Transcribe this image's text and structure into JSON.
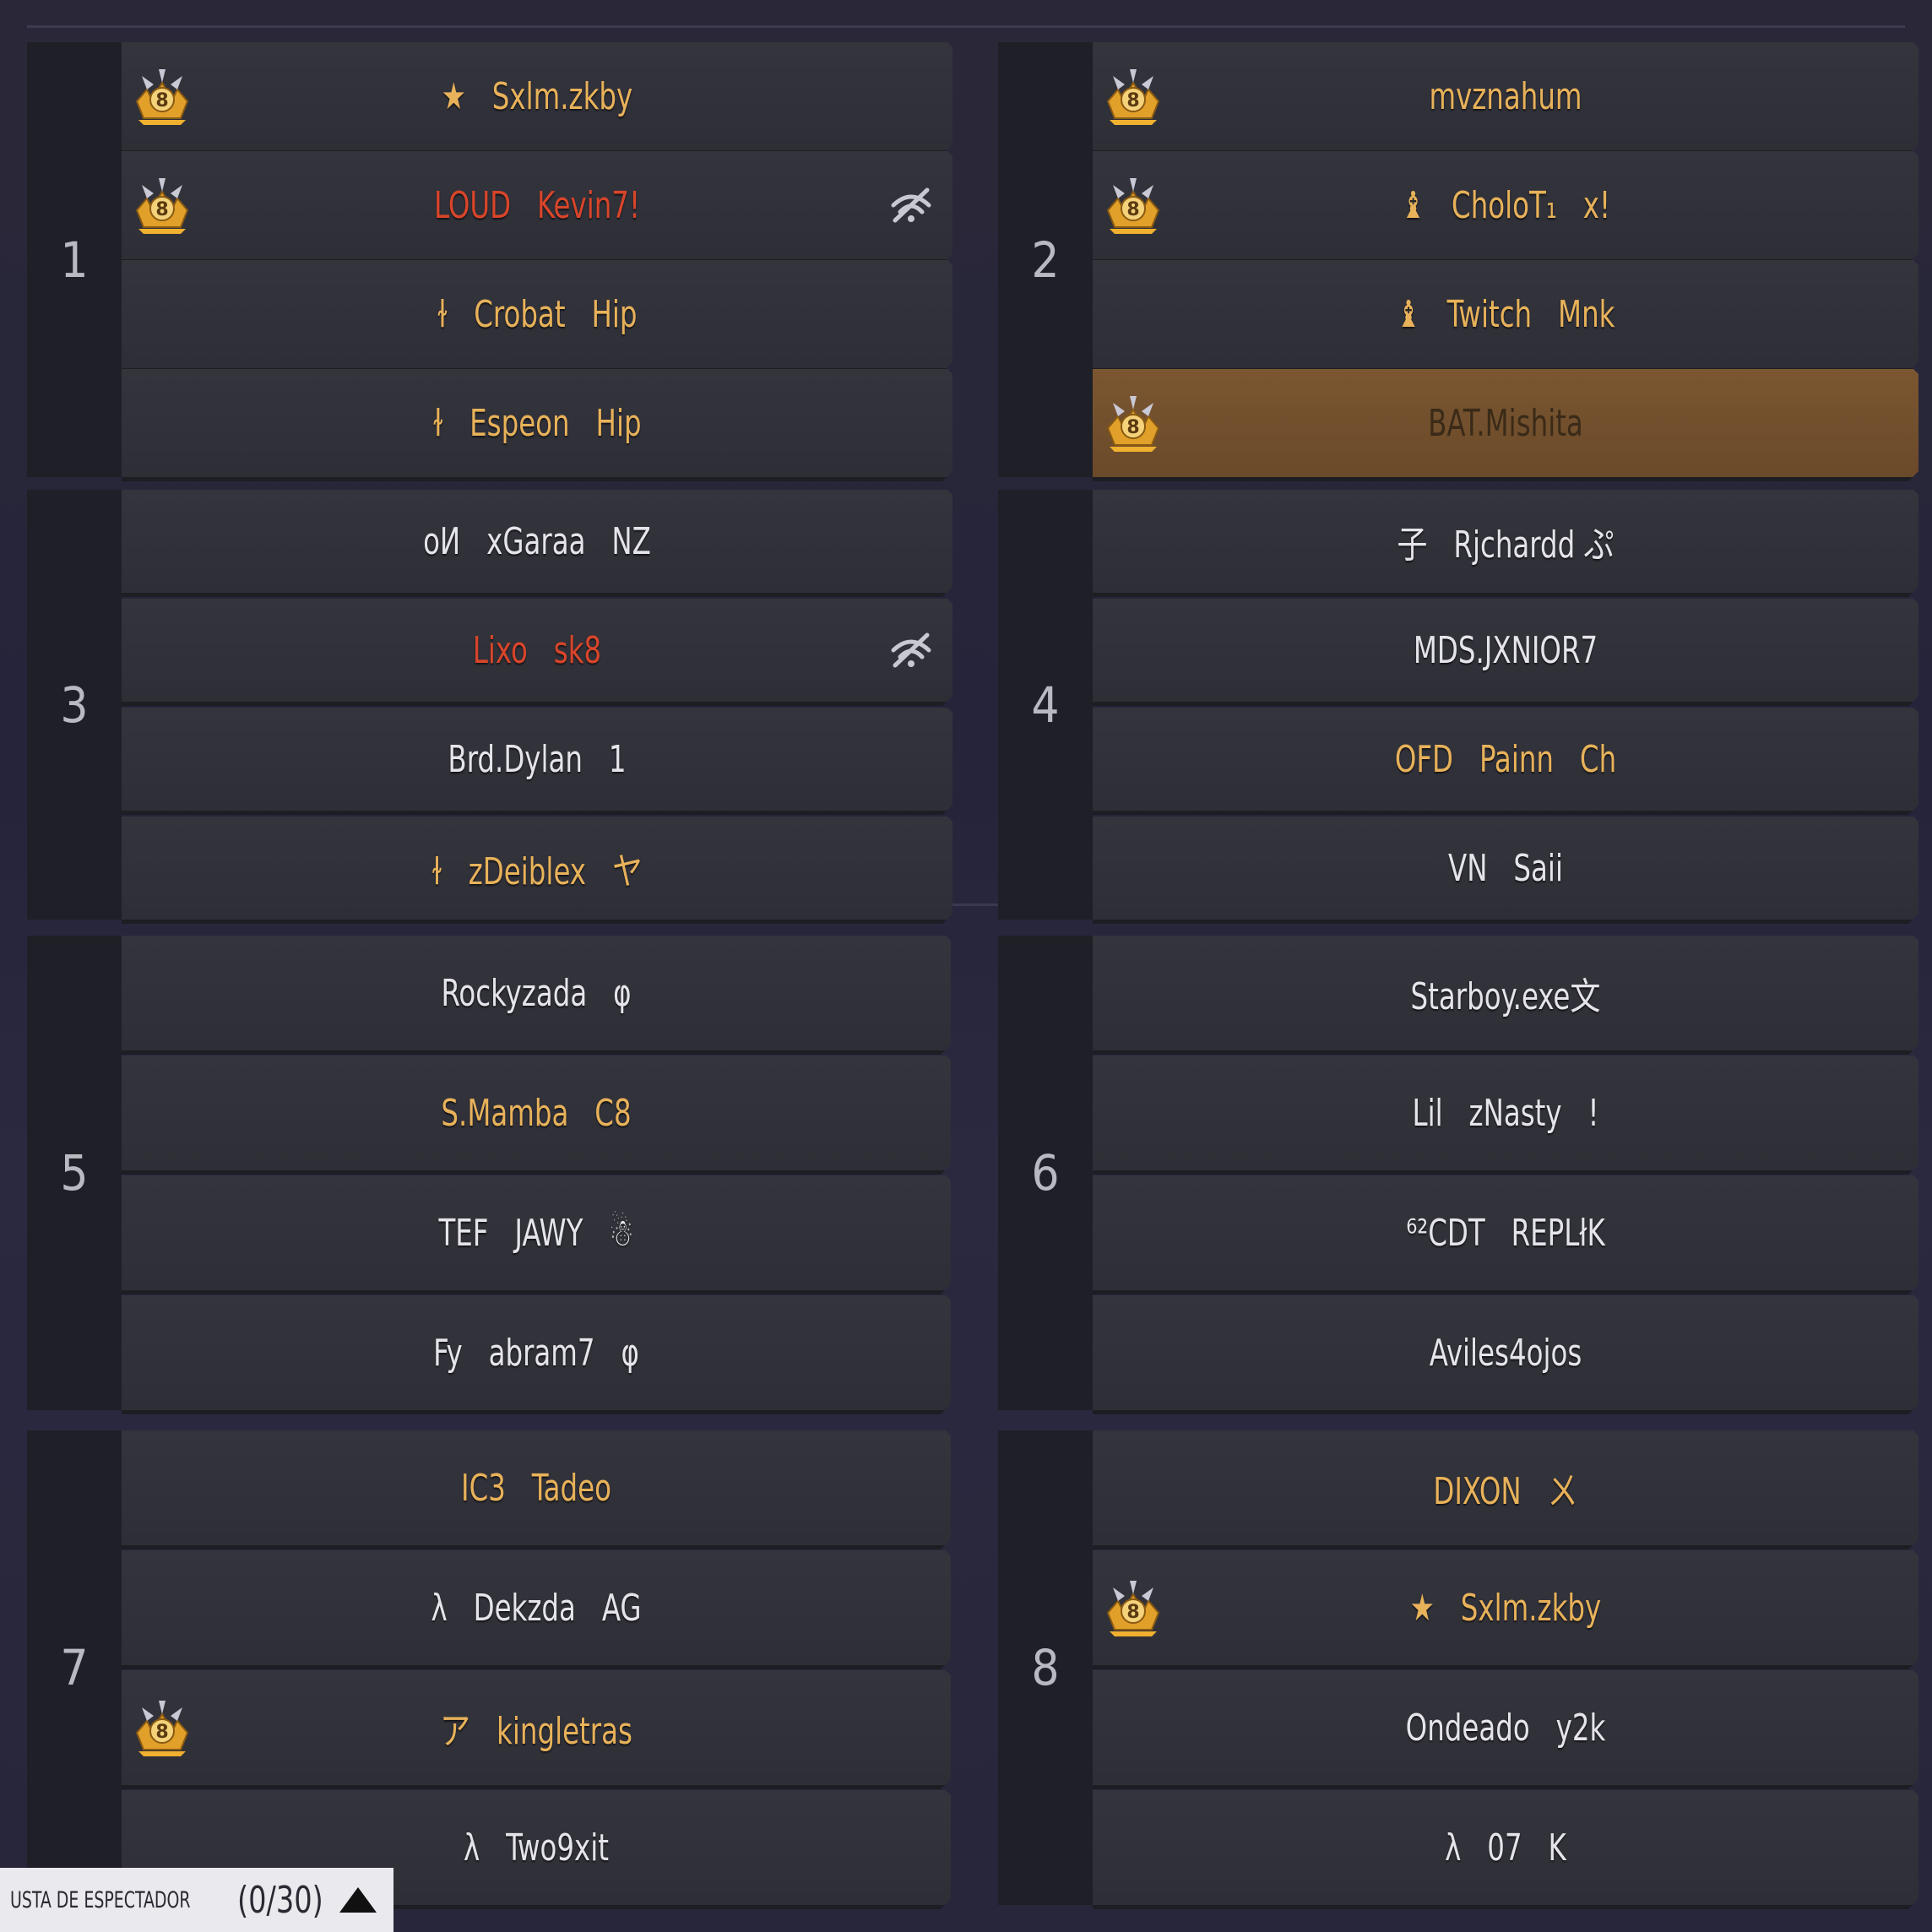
{
  "teams": [
    {
      "number": "1",
      "players": [
        {
          "name": "★   Sxlm.zkby",
          "color": "gold",
          "badge": true
        },
        {
          "name": "LOUD   Kevin7!",
          "color": "red",
          "badge": true,
          "signal": true
        },
        {
          "name": "ɫ   Crobat   Hip",
          "color": "gold"
        },
        {
          "name": "ɫ   Espeon   Hip",
          "color": "gold"
        }
      ]
    },
    {
      "number": "2",
      "players": [
        {
          "name": "mvznahum",
          "color": "gold",
          "badge": true
        },
        {
          "name": "♝   CholoT₁   x!",
          "color": "gold",
          "badge": true
        },
        {
          "name": "♝   Twitch   Mnk",
          "color": "gold"
        },
        {
          "name": "BAT.Mishita",
          "color": "darkgold",
          "badge": true,
          "highlight": true
        }
      ]
    },
    {
      "number": "3",
      "players": [
        {
          "name": "oИ   xGaraa   NZ",
          "color": "white"
        },
        {
          "name": "Lixo   sk8",
          "color": "red",
          "signal": true
        },
        {
          "name": "Brd.Dylan   1",
          "color": "white"
        },
        {
          "name": "ɫ   zDeiblex   ヤ",
          "color": "gold"
        }
      ]
    },
    {
      "number": "4",
      "players": [
        {
          "name": "子   Rjchardd ぷ",
          "color": "white"
        },
        {
          "name": "MDS.JXNIOR7",
          "color": "white"
        },
        {
          "name": "OFD   Painn   Ch",
          "color": "gold"
        },
        {
          "name": "VN   Saii",
          "color": "white"
        }
      ]
    },
    {
      "number": "5",
      "players": [
        {
          "name": "Rockyzada   φ",
          "color": "white"
        },
        {
          "name": "S.Mamba   C8",
          "color": "gold"
        },
        {
          "name": "TEF   JAWY   ☃",
          "color": "white"
        },
        {
          "name": "Fy   abram7   φ",
          "color": "white"
        }
      ]
    },
    {
      "number": "6",
      "players": [
        {
          "name": "Starboy.exe文",
          "color": "white"
        },
        {
          "name": "Lil   zNasty   !",
          "color": "white"
        },
        {
          "name": "⁶²CDT   REPLłK",
          "color": "white"
        },
        {
          "name": "Aviles4ojos",
          "color": "white"
        }
      ]
    },
    {
      "number": "7",
      "players": [
        {
          "name": "IC3   Tadeo",
          "color": "gold"
        },
        {
          "name": "λ   Dekzda   AG",
          "color": "white"
        },
        {
          "name": "ア   kingletras",
          "color": "gold",
          "badge": true
        },
        {
          "name": "λ   Two9xit",
          "color": "white"
        }
      ]
    },
    {
      "number": "8",
      "players": [
        {
          "name": "DIXON   ㄨ",
          "color": "gold"
        },
        {
          "name": "★   Sxlm.zkby",
          "color": "gold",
          "badge": true
        },
        {
          "name": "Ondeado   y2k",
          "color": "white"
        },
        {
          "name": "λ   07   K",
          "color": "white"
        }
      ]
    }
  ],
  "footer": {
    "label": "USTA DE ESPECTADOR",
    "count": "(0/30)"
  },
  "colors": {
    "gold": "#e8b25a",
    "red": "#d8452a",
    "white": "#e4e4ea",
    "highlight": "#7b5630"
  }
}
